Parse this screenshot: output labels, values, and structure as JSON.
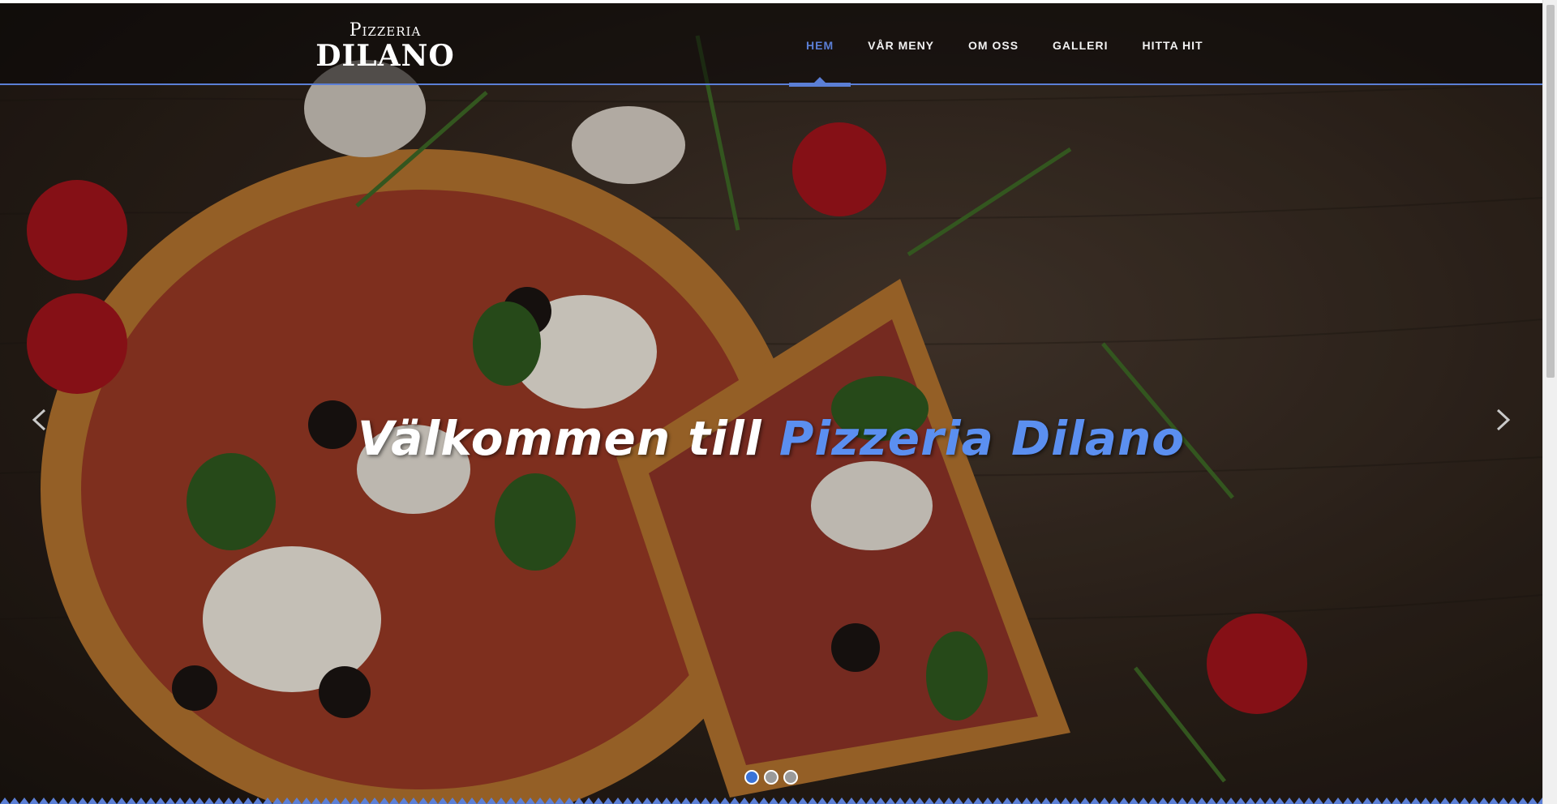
{
  "brand": {
    "logo_top": "Pizzeria",
    "logo_main": "DILANO"
  },
  "nav": {
    "items": [
      {
        "label": "HEM",
        "active": true
      },
      {
        "label": "VÅR MENY",
        "active": false
      },
      {
        "label": "OM OSS",
        "active": false
      },
      {
        "label": "GALLERI",
        "active": false
      },
      {
        "label": "HITTA HIT",
        "active": false
      }
    ]
  },
  "hero": {
    "headline_white": "Välkommen till",
    "headline_accent": "Pizzeria Dilano",
    "prev_icon": "chevron-left-icon",
    "next_icon": "chevron-right-icon",
    "slides_count": 3,
    "active_slide": 1
  },
  "colors": {
    "accent": "#5b7fd6",
    "headline_accent": "#5b8ff0",
    "header_bg": "#0a0808"
  }
}
